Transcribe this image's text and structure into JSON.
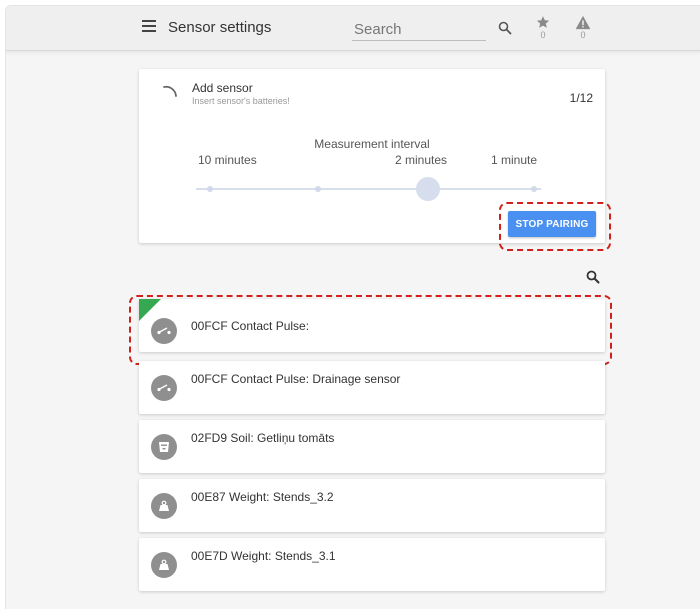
{
  "header": {
    "title": "Sensor settings",
    "search_placeholder": "Search",
    "favorites_count": "0",
    "alerts_count": "0"
  },
  "pairing": {
    "title": "Add sensor",
    "subtitle": "Insert sensor's batteries!",
    "step": "1/12",
    "interval_label": "Measurement interval",
    "options": [
      "10 minutes",
      "2 minutes",
      "1 minute"
    ],
    "selected_option": "2 minutes",
    "stop_button": "STOP PAIRING"
  },
  "sensors": [
    {
      "name": "00FCF Contact Pulse:",
      "icon": "contact-pulse-icon",
      "is_new": true,
      "highlighted": true
    },
    {
      "name": "00FCF Contact Pulse: Drainage sensor",
      "icon": "contact-pulse-icon",
      "is_new": false,
      "highlighted": false
    },
    {
      "name": "02FD9 Soil: Getliņu tomāts",
      "icon": "soil-pot-icon",
      "is_new": false,
      "highlighted": false
    },
    {
      "name": "00E87 Weight: Stends_3.2",
      "icon": "weight-icon",
      "is_new": false,
      "highlighted": false
    },
    {
      "name": "00E7D Weight: Stends_3.1",
      "icon": "weight-icon",
      "is_new": false,
      "highlighted": false
    }
  ],
  "colors": {
    "accent": "#4a90f0",
    "new_badge": "#36a852",
    "highlight": "#d0201b",
    "avatar": "#8f8f8f"
  }
}
